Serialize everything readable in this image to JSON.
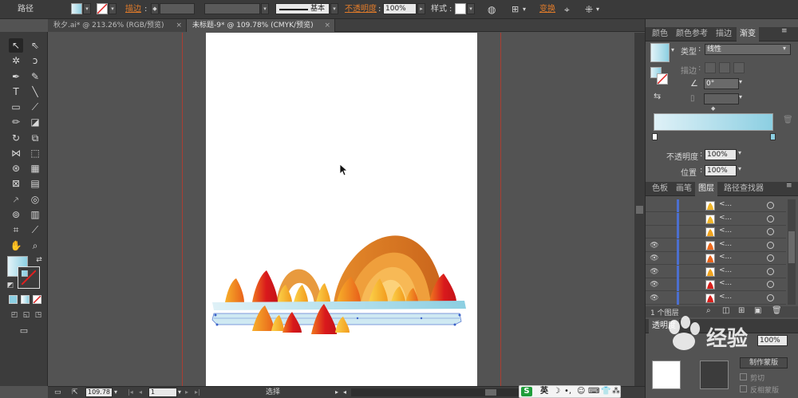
{
  "control_bar": {
    "object_type": "路径",
    "stroke_label": "描边",
    "stroke_value": "",
    "brush_label": "基本",
    "opacity_label": "不透明度",
    "opacity_value": "100%",
    "style_label": "样式",
    "transform_label": "变换"
  },
  "tabs": [
    {
      "label": "秋夕.ai* @ 213.26% (RGB/预览)",
      "active": false
    },
    {
      "label": "未标题-9* @ 109.78% (CMYK/预览)",
      "active": true
    }
  ],
  "status_bar": {
    "zoom": "109.78",
    "page": "1",
    "mode": "选择"
  },
  "gradient_panel": {
    "tabs": [
      "颜色",
      "颜色参考",
      "描边",
      "渐变"
    ],
    "active_tab": "渐变",
    "type_label": "类型",
    "type_value": "线性",
    "stroke_label": "描边",
    "angle_value": "0°",
    "opacity_label": "不透明度",
    "opacity_value": "100%",
    "location_label": "位置",
    "location_value": "100%",
    "gradient_start": "#dff1f7",
    "gradient_end": "#8ccfe2"
  },
  "layers_panel": {
    "tabs": [
      "色板",
      "画笔",
      "图层",
      "路径查找器"
    ],
    "active_tab": "图层",
    "rows": [
      {
        "name": "<...",
        "visible": false,
        "thumb": "#f0b52a"
      },
      {
        "name": "<...",
        "visible": false,
        "thumb": "#f0b52a"
      },
      {
        "name": "<...",
        "visible": false,
        "thumb": "#f0a31e"
      },
      {
        "name": "<...",
        "visible": true,
        "thumb": "#ee6a1e"
      },
      {
        "name": "<...",
        "visible": true,
        "thumb": "#e8621a"
      },
      {
        "name": "<...",
        "visible": true,
        "thumb": "#f0a31e"
      },
      {
        "name": "<...",
        "visible": true,
        "thumb": "#d8201c"
      },
      {
        "name": "<...",
        "visible": true,
        "thumb": "#d8201c"
      }
    ],
    "count_label": "1 个图层"
  },
  "transparency_panel": {
    "title": "透明度",
    "opacity_value": "100%",
    "make_mask_label": "制作蒙版",
    "clip_label": "剪切",
    "invert_label": "反相蒙版"
  },
  "watermark": {
    "text": "经验"
  },
  "ime": {
    "label": "英"
  }
}
